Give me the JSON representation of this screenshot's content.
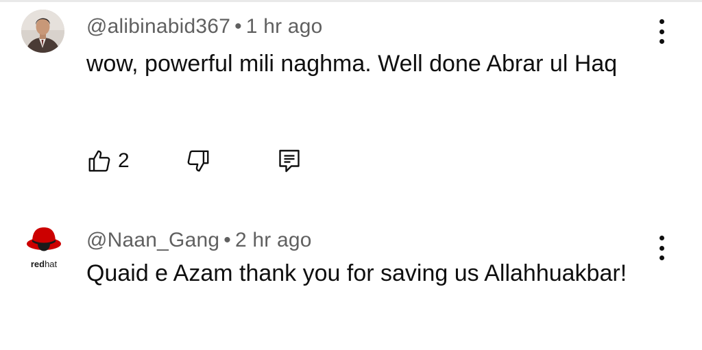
{
  "comments": [
    {
      "handle": "@alibinabid367",
      "separator": "•",
      "time": "1 hr ago",
      "text": "wow, powerful mili naghma. Well done Abrar ul Haq",
      "like_count": "2"
    },
    {
      "handle": "@Naan_Gang",
      "separator": "•",
      "time": "2 hr ago",
      "text": "Quaid e Azam thank you for saving us Allahhuakbar!",
      "avatar_logo_text": "redhat"
    }
  ],
  "icons": {
    "like": "thumbs-up-icon",
    "dislike": "thumbs-down-icon",
    "reply": "reply-comment-icon",
    "more": "more-vertical-icon"
  },
  "colors": {
    "text": "#0f0f0f",
    "meta": "#606060",
    "redhat_red": "#cc0000"
  }
}
